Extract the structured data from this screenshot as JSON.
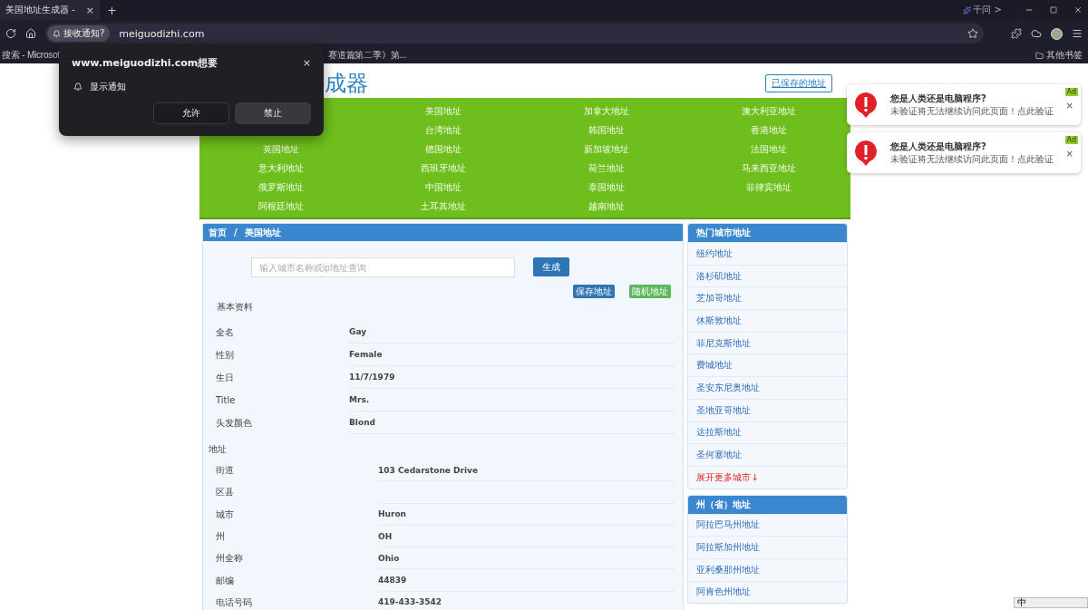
{
  "browser": {
    "tab": {
      "title": "美国地址生成器 -",
      "close": "×"
    },
    "new_tab": "+",
    "assistant": "千问 >",
    "permission_chip": "接收通知?",
    "url": "meiguodizhi.com",
    "bookmarks": [
      "搜索 - Microsof",
      "赛道篇第二季》第..."
    ],
    "other_bookmarks": "其他书签"
  },
  "popup": {
    "title": "www.meiguodizhi.com想要",
    "close": "×",
    "permission": "显示通知",
    "buttons": [
      {
        "label": "允许",
        "selected": false
      },
      {
        "label": "禁止",
        "selected": true
      }
    ]
  },
  "header": {
    "title": "成器",
    "saved_button": "已保存的地址"
  },
  "nav": {
    "columns": [
      [
        "英国地址",
        "意大利地址",
        "俄罗斯地址",
        "阿根廷地址"
      ],
      [
        "美国地址",
        "台湾地址",
        "德国地址",
        "西班牙地址",
        "中国地址",
        "土耳其地址"
      ],
      [
        "加拿大地址",
        "韩国地址",
        "新加坡地址",
        "荷兰地址",
        "泰国地址",
        "越南地址"
      ],
      [
        "澳大利亚地址",
        "香港地址",
        "法国地址",
        "马来西亚地址",
        "菲律宾地址"
      ]
    ]
  },
  "breadcrumb": [
    "首页",
    "/",
    "美国地址"
  ],
  "search": {
    "placeholder": "输入城市名称或ip地址查询",
    "button": "生成"
  },
  "actions": [
    {
      "label": "保存地址",
      "kind": "primary"
    },
    {
      "label": "随机地址",
      "kind": "success"
    }
  ],
  "sections": [
    {
      "title": "基本资料",
      "kind": "profile",
      "fields": [
        {
          "label": "全名",
          "value": "Gay"
        },
        {
          "label": "性别",
          "value": "Female"
        },
        {
          "label": "生日",
          "value": "11/7/1979"
        },
        {
          "label": "Title",
          "value": "Mrs."
        },
        {
          "label": "头发颜色",
          "value": "Blond"
        }
      ]
    },
    {
      "title": "地址",
      "kind": "address",
      "fields": [
        {
          "label": "街道",
          "value": "103  Cedarstone Drive"
        },
        {
          "label": "区县"
        },
        {
          "label": "城市",
          "value": "Huron"
        },
        {
          "label": "州",
          "value": "OH"
        },
        {
          "label": "州全称",
          "value": "Ohio"
        },
        {
          "label": "邮编",
          "value": "44839"
        },
        {
          "label": "电话号码",
          "value": "419-433-3542"
        }
      ]
    }
  ],
  "sidebar": [
    {
      "title": "热门城市地址",
      "items": [
        {
          "label": "纽约地址",
          "kind": "link"
        },
        {
          "label": "洛杉矶地址",
          "kind": "link"
        },
        {
          "label": "芝加哥地址",
          "kind": "link"
        },
        {
          "label": "休斯敦地址",
          "kind": "link"
        },
        {
          "label": "菲尼克斯地址",
          "kind": "link"
        },
        {
          "label": "费城地址",
          "kind": "link"
        },
        {
          "label": "圣安东尼奥地址",
          "kind": "link"
        },
        {
          "label": "圣地亚哥地址",
          "kind": "link"
        },
        {
          "label": "达拉斯地址",
          "kind": "link"
        },
        {
          "label": "圣何塞地址",
          "kind": "link"
        },
        {
          "label": "展开更多城市↓",
          "kind": "more"
        }
      ]
    },
    {
      "title": "州（省）地址",
      "items": [
        {
          "label": "阿拉巴马州地址",
          "kind": "link"
        },
        {
          "label": "阿拉斯加州地址",
          "kind": "link"
        },
        {
          "label": "亚利桑那州地址",
          "kind": "link"
        },
        {
          "label": "阿肯色州地址",
          "kind": "link"
        }
      ]
    }
  ],
  "ads": [
    {
      "badge": "Ad",
      "title": "您是人类还是电脑程序?",
      "text": "未验证将无法继续访问此页面！点此验证",
      "close": "×"
    },
    {
      "badge": "Ad",
      "title": "您是人类还是电脑程序?",
      "text": "未验证将无法继续访问此页面！点此验证",
      "close": "×"
    }
  ],
  "ime": {
    "label": "中"
  }
}
